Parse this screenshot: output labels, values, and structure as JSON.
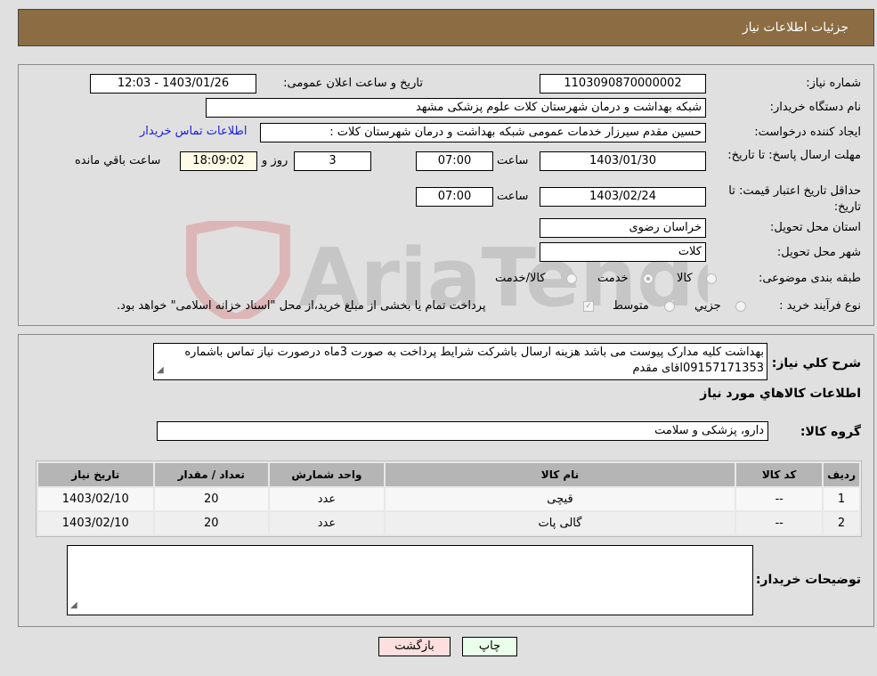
{
  "header": {
    "title": "جزئیات اطلاعات نیاز"
  },
  "details": {
    "need_number": {
      "label": "شماره نیاز:",
      "value": "1103090870000002"
    },
    "announce_datetime": {
      "label": "تاریخ و ساعت اعلان عمومی:",
      "value": "1403/01/26 - 12:03"
    },
    "buyer_org": {
      "label": "نام دستگاه خریدار:",
      "value": "شبکه بهداشت و درمان شهرستان کلات   علوم پزشکی مشهد"
    },
    "requester": {
      "label": "ایجاد کننده درخواست:",
      "value": "حسین مقدم سیرزار خدمات عمومی شبکه بهداشت و درمان شهرستان کلات   :"
    },
    "buyer_contact_link": "اطلاعات تماس خریدار",
    "response_deadline": {
      "label": "مهلت ارسال پاسخ: تا تاریخ:",
      "date": "1403/01/30",
      "time_label": "ساعت",
      "time": "07:00",
      "days": "3",
      "days_label": "روز و",
      "remaining_time": "18:09:02",
      "remaining_label": "ساعت باقي مانده"
    },
    "price_validity": {
      "label": "حداقل تاریخ اعتبار قیمت: تا تاریخ:",
      "date": "1403/02/24",
      "time_label": "ساعت",
      "time": "07:00"
    },
    "delivery_province": {
      "label": "استان محل تحویل:",
      "value": "خراسان رضوی"
    },
    "delivery_city": {
      "label": "شهر محل تحویل:",
      "value": "کلات"
    },
    "category": {
      "label": "طبقه بندی موضوعی:",
      "options": [
        "کالا",
        "خدمت",
        "کالا/خدمت"
      ],
      "selected": "خدمت"
    },
    "purchase_type": {
      "label": "نوع فرآیند خرید :",
      "options": [
        "جزيي",
        "متوسط"
      ],
      "checkbox_label": "پرداخت تمام یا بخشی از مبلغ خرید،از محل \"اسناد خزانه اسلامی\" خواهد بود."
    }
  },
  "description": {
    "label": "شرح كلي نياز:",
    "value": "بهداشت کلیه مدارک پیوست می باشد هزینه ارسال باشرکت شرایط پرداخت به صورت 3ماه درصورت نیاز تماس باشماره 09157171353اقای مقدم"
  },
  "goods_section": {
    "title": "اطلاعات كالاهاي مورد نياز",
    "group_label": "گروه کالا:",
    "group_value": "دارو، پزشکی و سلامت",
    "table": {
      "headers": [
        "ردیف",
        "کد کالا",
        "نام کالا",
        "واحد شمارش",
        "تعداد / مقدار",
        "تاریخ نیاز"
      ],
      "rows": [
        [
          "1",
          "--",
          "قیچی",
          "عدد",
          "20",
          "1403/02/10"
        ],
        [
          "2",
          "--",
          "گالی پات",
          "عدد",
          "20",
          "1403/02/10"
        ]
      ]
    }
  },
  "buyer_notes": {
    "label": "توضیحات خریدار:",
    "value": ""
  },
  "buttons": {
    "print": "چاپ",
    "back": "بازگشت"
  },
  "watermark": {
    "text": "AriaTender.neT"
  },
  "colors": {
    "header_bg": "#8b6c43",
    "link": "#1a1adf",
    "print_bg": "#eaffea",
    "back_bg": "#ffdede"
  }
}
